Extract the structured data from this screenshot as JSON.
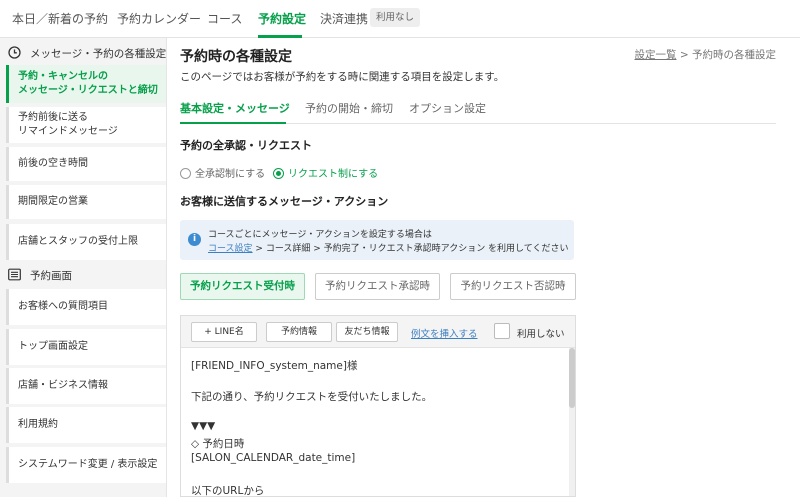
{
  "topnav": {
    "tabs": [
      "本日／新着の予約",
      "予約カレンダー",
      "コース",
      "予約設定",
      "決済連携"
    ],
    "active_index": 3,
    "badge": "利用なし"
  },
  "sidebar": {
    "sections": [
      {
        "heading": "メッセージ・予約の各種設定",
        "icon": "clock-icon",
        "items": [
          {
            "lines": [
              "予約・キャンセルの",
              "メッセージ・リクエストと締切"
            ],
            "active": true
          },
          {
            "lines": [
              "予約前後に送る",
              "リマインドメッセージ"
            ]
          },
          {
            "lines": [
              "前後の空き時間"
            ]
          },
          {
            "lines": [
              "期間限定の営業"
            ]
          },
          {
            "lines": [
              "店舗とスタッフの受付上限"
            ]
          }
        ]
      },
      {
        "heading": "予約画面",
        "icon": "list-icon",
        "items": [
          {
            "lines": [
              "お客様への質問項目"
            ]
          },
          {
            "lines": [
              "トップ画面設定"
            ]
          },
          {
            "lines": [
              "店舗・ビジネス情報"
            ]
          },
          {
            "lines": [
              "利用規約"
            ]
          },
          {
            "lines": [
              "システムワード変更 / 表示設定"
            ]
          }
        ]
      }
    ]
  },
  "main": {
    "title": "予約時の各種設定",
    "description": "このページではお客様が予約をする時に関連する項目を設定します。",
    "breadcrumb": {
      "link": "設定一覧",
      "sep": ">",
      "current": "予約時の各種設定"
    },
    "subtabs": [
      "基本設定・メッセージ",
      "予約の開始・締切",
      "オプション設定"
    ],
    "approval": {
      "title": "予約の全承認・リクエスト",
      "options": [
        "全承認制にする",
        "リクエスト制にする"
      ],
      "selected_index": 1
    },
    "messages": {
      "title": "お客様に送信するメッセージ・アクション",
      "info_line1": "コースごとにメッセージ・アクションを設定する場合は",
      "info_link": "コース設定",
      "info_line2_rest": " > コース詳細 > 予約完了・リクエスト承認時アクション を利用してください",
      "buttons": [
        "予約リクエスト受付時",
        "予約リクエスト承認時",
        "予約リクエスト否認時"
      ],
      "active_button": 0
    },
    "editor": {
      "toolbar": [
        "+ LINE名",
        "予約情報",
        "友だち情報"
      ],
      "insert_example": "例文を挿入する",
      "disable_label": "利用しない",
      "body_lines": [
        "[FRIEND_INFO_system_name]様",
        "",
        "下記の通り、予約リクエストを受付いたしました。",
        "",
        "▼▼▼",
        "◇ 予約日時",
        "[SALON_CALENDAR_date_time]",
        "",
        "以下のURLから"
      ]
    }
  },
  "colors": {
    "accent": "#06a04a",
    "link": "#3d7fc1",
    "info_bg": "#eaf1f9"
  }
}
